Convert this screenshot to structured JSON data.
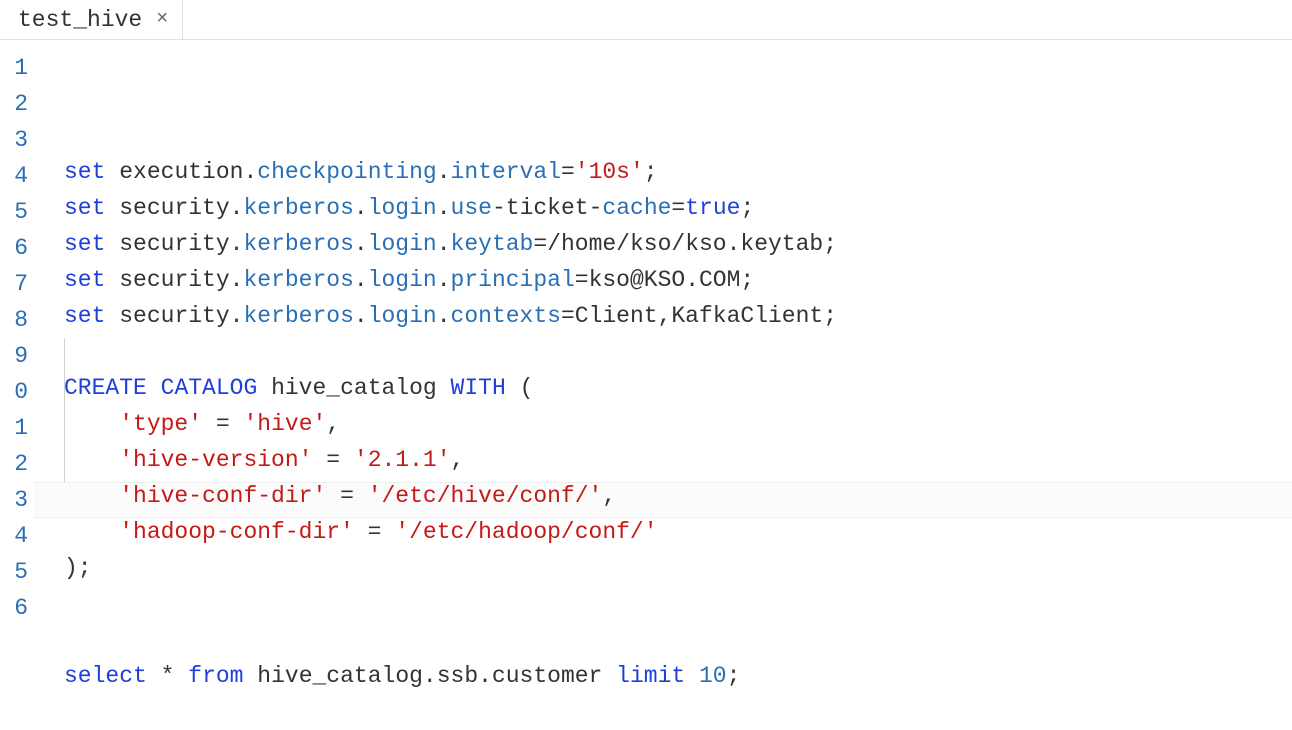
{
  "tab": {
    "label": "test_hive"
  },
  "gutter": [
    "1",
    "2",
    "3",
    "4",
    "5",
    "6",
    "7",
    "8",
    "9",
    "0",
    "1",
    "2",
    "3",
    "4",
    "5",
    "6"
  ],
  "lines": [
    [
      {
        "cls": "kw",
        "t": "set"
      },
      {
        "cls": "",
        "t": " "
      },
      {
        "cls": "name",
        "t": "execution"
      },
      {
        "cls": "dot",
        "t": "."
      },
      {
        "cls": "id",
        "t": "checkpointing"
      },
      {
        "cls": "dot",
        "t": "."
      },
      {
        "cls": "id",
        "t": "interval"
      },
      {
        "cls": "op",
        "t": "="
      },
      {
        "cls": "str",
        "t": "'10s'"
      },
      {
        "cls": "punc",
        "t": ";"
      }
    ],
    [
      {
        "cls": "kw",
        "t": "set"
      },
      {
        "cls": "",
        "t": " "
      },
      {
        "cls": "name",
        "t": "security"
      },
      {
        "cls": "dot",
        "t": "."
      },
      {
        "cls": "id",
        "t": "kerberos"
      },
      {
        "cls": "dot",
        "t": "."
      },
      {
        "cls": "id",
        "t": "login"
      },
      {
        "cls": "dot",
        "t": "."
      },
      {
        "cls": "id",
        "t": "use"
      },
      {
        "cls": "op",
        "t": "-"
      },
      {
        "cls": "name",
        "t": "ticket"
      },
      {
        "cls": "op",
        "t": "-"
      },
      {
        "cls": "id",
        "t": "cache"
      },
      {
        "cls": "op",
        "t": "="
      },
      {
        "cls": "bool",
        "t": "true"
      },
      {
        "cls": "punc",
        "t": ";"
      }
    ],
    [
      {
        "cls": "kw",
        "t": "set"
      },
      {
        "cls": "",
        "t": " "
      },
      {
        "cls": "name",
        "t": "security"
      },
      {
        "cls": "dot",
        "t": "."
      },
      {
        "cls": "id",
        "t": "kerberos"
      },
      {
        "cls": "dot",
        "t": "."
      },
      {
        "cls": "id",
        "t": "login"
      },
      {
        "cls": "dot",
        "t": "."
      },
      {
        "cls": "id",
        "t": "keytab"
      },
      {
        "cls": "op",
        "t": "="
      },
      {
        "cls": "name",
        "t": "/home/kso/kso.keytab"
      },
      {
        "cls": "punc",
        "t": ";"
      }
    ],
    [
      {
        "cls": "kw",
        "t": "set"
      },
      {
        "cls": "",
        "t": " "
      },
      {
        "cls": "name",
        "t": "security"
      },
      {
        "cls": "dot",
        "t": "."
      },
      {
        "cls": "id",
        "t": "kerberos"
      },
      {
        "cls": "dot",
        "t": "."
      },
      {
        "cls": "id",
        "t": "login"
      },
      {
        "cls": "dot",
        "t": "."
      },
      {
        "cls": "id",
        "t": "principal"
      },
      {
        "cls": "op",
        "t": "="
      },
      {
        "cls": "name",
        "t": "kso@KSO.COM"
      },
      {
        "cls": "punc",
        "t": ";"
      }
    ],
    [
      {
        "cls": "kw",
        "t": "set"
      },
      {
        "cls": "",
        "t": " "
      },
      {
        "cls": "name",
        "t": "security"
      },
      {
        "cls": "dot",
        "t": "."
      },
      {
        "cls": "id",
        "t": "kerberos"
      },
      {
        "cls": "dot",
        "t": "."
      },
      {
        "cls": "id",
        "t": "login"
      },
      {
        "cls": "dot",
        "t": "."
      },
      {
        "cls": "id",
        "t": "contexts"
      },
      {
        "cls": "op",
        "t": "="
      },
      {
        "cls": "name",
        "t": "Client,KafkaClient"
      },
      {
        "cls": "punc",
        "t": ";"
      }
    ],
    [],
    [
      {
        "cls": "kw",
        "t": "CREATE"
      },
      {
        "cls": "",
        "t": " "
      },
      {
        "cls": "kw",
        "t": "CATALOG"
      },
      {
        "cls": "",
        "t": " "
      },
      {
        "cls": "name",
        "t": "hive_catalog"
      },
      {
        "cls": "",
        "t": " "
      },
      {
        "cls": "kw",
        "t": "WITH"
      },
      {
        "cls": "",
        "t": " "
      },
      {
        "cls": "punc",
        "t": "("
      }
    ],
    [
      {
        "cls": "",
        "t": "    "
      },
      {
        "cls": "str",
        "t": "'type'"
      },
      {
        "cls": "",
        "t": " "
      },
      {
        "cls": "op",
        "t": "="
      },
      {
        "cls": "",
        "t": " "
      },
      {
        "cls": "str",
        "t": "'hive'"
      },
      {
        "cls": "punc",
        "t": ","
      }
    ],
    [
      {
        "cls": "",
        "t": "    "
      },
      {
        "cls": "str",
        "t": "'hive-version'"
      },
      {
        "cls": "",
        "t": " "
      },
      {
        "cls": "op",
        "t": "="
      },
      {
        "cls": "",
        "t": " "
      },
      {
        "cls": "str",
        "t": "'2.1.1'"
      },
      {
        "cls": "punc",
        "t": ","
      }
    ],
    [
      {
        "cls": "",
        "t": "    "
      },
      {
        "cls": "str",
        "t": "'hive-conf-dir'"
      },
      {
        "cls": "",
        "t": " "
      },
      {
        "cls": "op",
        "t": "="
      },
      {
        "cls": "",
        "t": " "
      },
      {
        "cls": "str",
        "t": "'/etc/hive/conf/'"
      },
      {
        "cls": "punc",
        "t": ","
      }
    ],
    [
      {
        "cls": "",
        "t": "    "
      },
      {
        "cls": "str",
        "t": "'hadoop-conf-dir'"
      },
      {
        "cls": "",
        "t": " "
      },
      {
        "cls": "op",
        "t": "="
      },
      {
        "cls": "",
        "t": " "
      },
      {
        "cls": "str",
        "t": "'/etc/hadoop/conf/'"
      }
    ],
    [
      {
        "cls": "punc",
        "t": ");"
      }
    ],
    [],
    [],
    [
      {
        "cls": "kw",
        "t": "select"
      },
      {
        "cls": "",
        "t": " "
      },
      {
        "cls": "op",
        "t": "*"
      },
      {
        "cls": "",
        "t": " "
      },
      {
        "cls": "kw",
        "t": "from"
      },
      {
        "cls": "",
        "t": " "
      },
      {
        "cls": "name",
        "t": "hive_catalog.ssb.customer"
      },
      {
        "cls": "",
        "t": " "
      },
      {
        "cls": "kw",
        "t": "limit"
      },
      {
        "cls": "",
        "t": " "
      },
      {
        "cls": "num",
        "t": "10"
      },
      {
        "cls": "punc",
        "t": ";"
      }
    ],
    []
  ]
}
